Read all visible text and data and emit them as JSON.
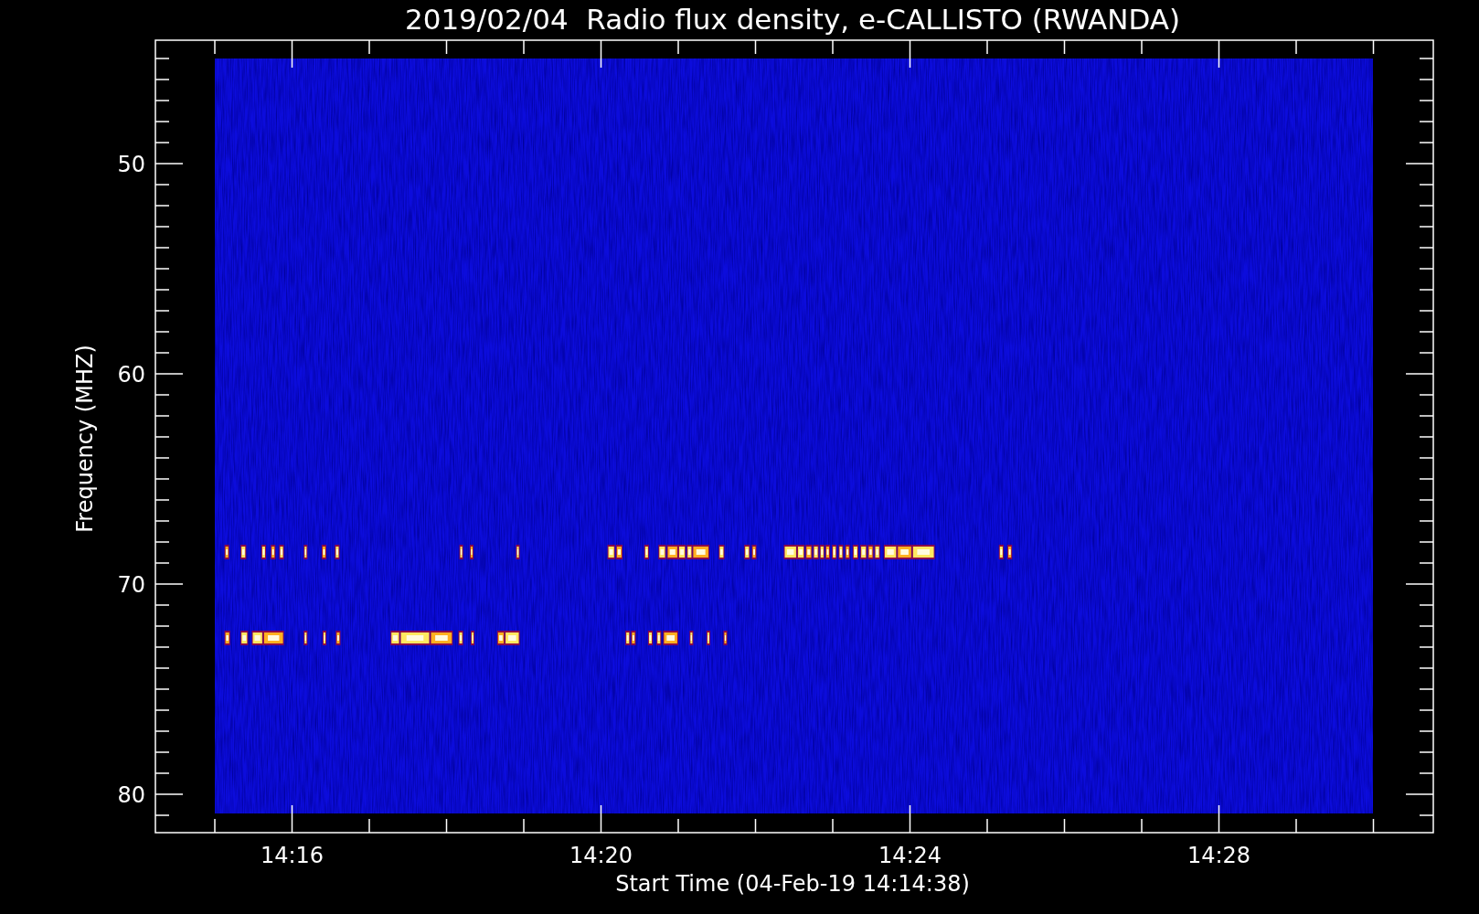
{
  "title": "2019/02/04  Radio flux density, e-CALLISTO (RWANDA)",
  "y_axis": {
    "label": "Frequency (MHZ)",
    "tick_labels": [
      "50",
      "60",
      "70",
      "80"
    ]
  },
  "x_axis": {
    "label": "Start Time (04-Feb-19 14:14:38)",
    "tick_labels": [
      "14:16",
      "14:20",
      "14:24",
      "14:28"
    ]
  }
}
